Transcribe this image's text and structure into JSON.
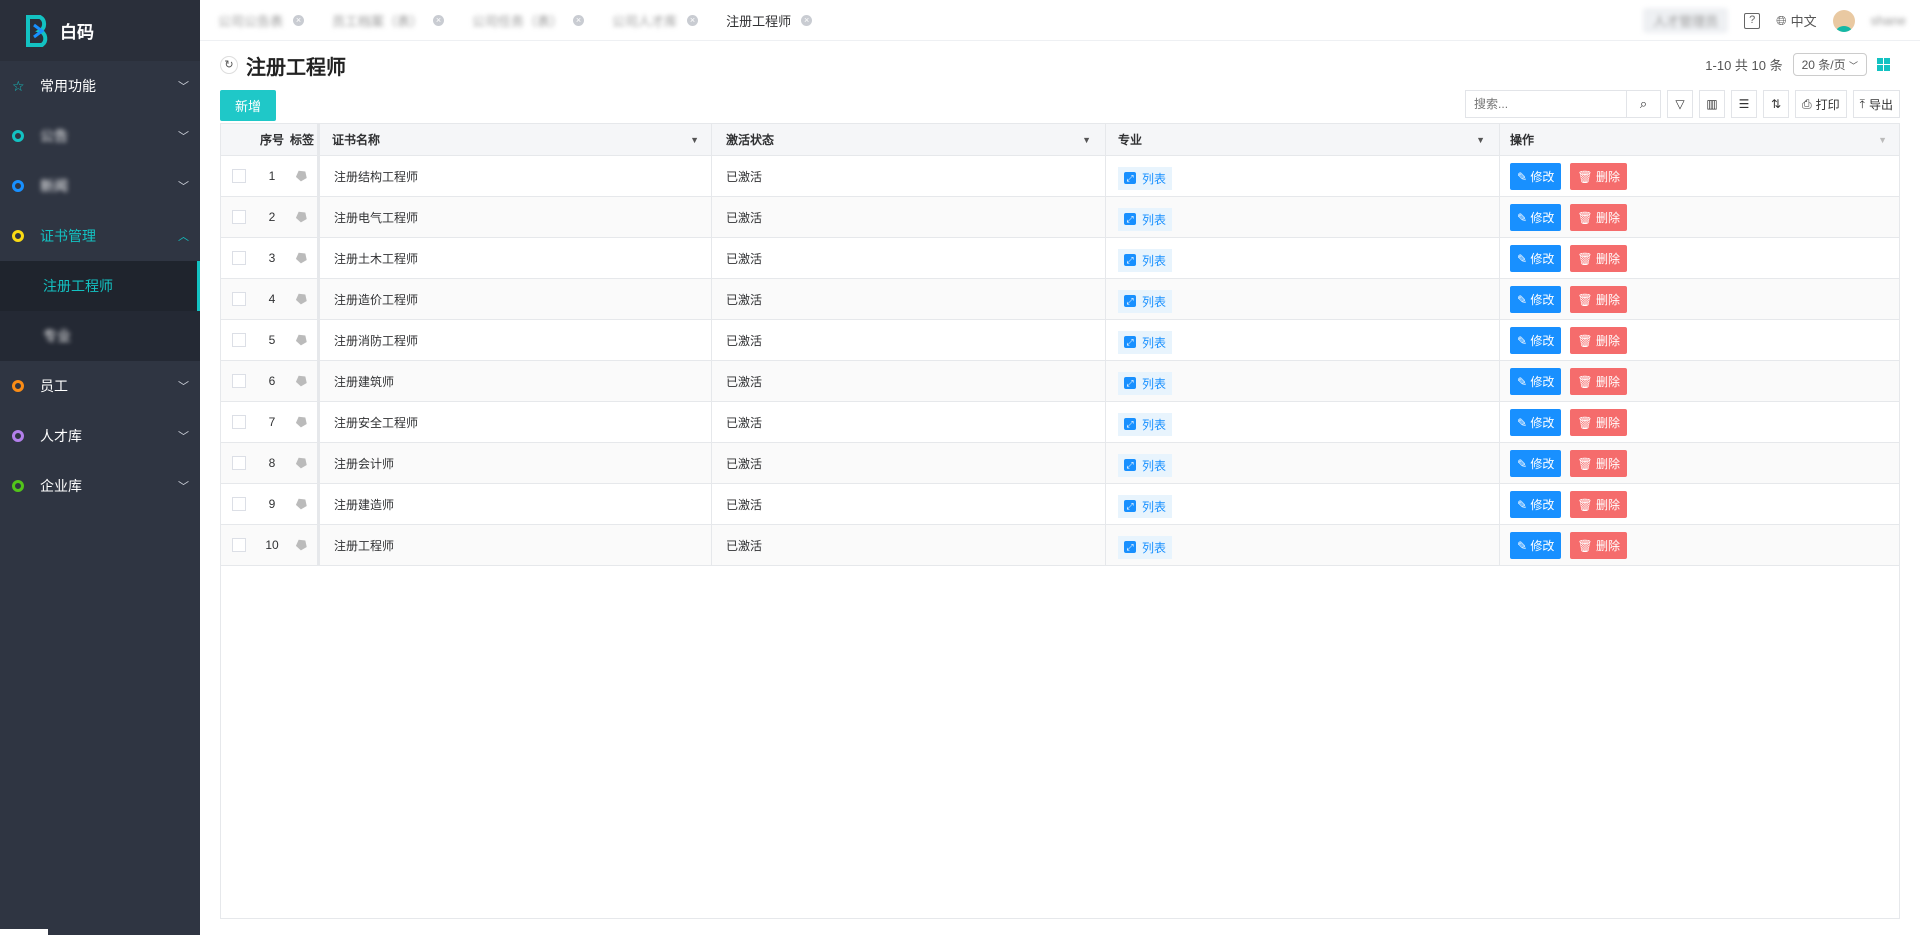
{
  "app": {
    "logo_text": "白码"
  },
  "sidebar": {
    "items": [
      {
        "label": "常用功能",
        "color": "#13c2c2"
      },
      {
        "label": "公告",
        "color": "#13c2c2"
      },
      {
        "label": "新闻",
        "color": "#1890ff"
      },
      {
        "label": "证书管理",
        "color": "#fadb14"
      },
      {
        "label": "员工",
        "color": "#fa8c16"
      },
      {
        "label": "人才库",
        "color": "#b37feb"
      },
      {
        "label": "企业库",
        "color": "#52c41a"
      }
    ],
    "sub_items": [
      {
        "label": "注册工程师"
      },
      {
        "label": "专业"
      }
    ]
  },
  "tabs": [
    {
      "label": "公司公告表"
    },
    {
      "label": "员工档案（表）"
    },
    {
      "label": "公司任务（表）"
    },
    {
      "label": "公司人才库"
    },
    {
      "label": "注册工程师"
    }
  ],
  "topbar": {
    "role": "人才管理员",
    "lang": "中文",
    "user": "shane"
  },
  "page": {
    "title": "注册工程师",
    "pager_text": "1-10 共 10 条",
    "page_size": "20 条/页",
    "new_label": "新增",
    "search_placeholder": "搜索...",
    "print_label": "打印",
    "export_label": "导出"
  },
  "table": {
    "headers": {
      "no": "序号",
      "tag": "标签",
      "name": "证书名称",
      "status": "激活状态",
      "major": "专业",
      "op": "操作"
    },
    "list_label": "列表",
    "edit_label": "修改",
    "delete_label": "删除",
    "rows": [
      {
        "no": "1",
        "name": "注册结构工程师",
        "status": "已激活"
      },
      {
        "no": "2",
        "name": "注册电气工程师",
        "status": "已激活"
      },
      {
        "no": "3",
        "name": "注册土木工程师",
        "status": "已激活"
      },
      {
        "no": "4",
        "name": "注册造价工程师",
        "status": "已激活"
      },
      {
        "no": "5",
        "name": "注册消防工程师",
        "status": "已激活"
      },
      {
        "no": "6",
        "name": "注册建筑师",
        "status": "已激活"
      },
      {
        "no": "7",
        "name": "注册安全工程师",
        "status": "已激活"
      },
      {
        "no": "8",
        "name": "注册会计师",
        "status": "已激活"
      },
      {
        "no": "9",
        "name": "注册建造师",
        "status": "已激活"
      },
      {
        "no": "10",
        "name": "注册工程师",
        "status": "已激活"
      }
    ]
  }
}
